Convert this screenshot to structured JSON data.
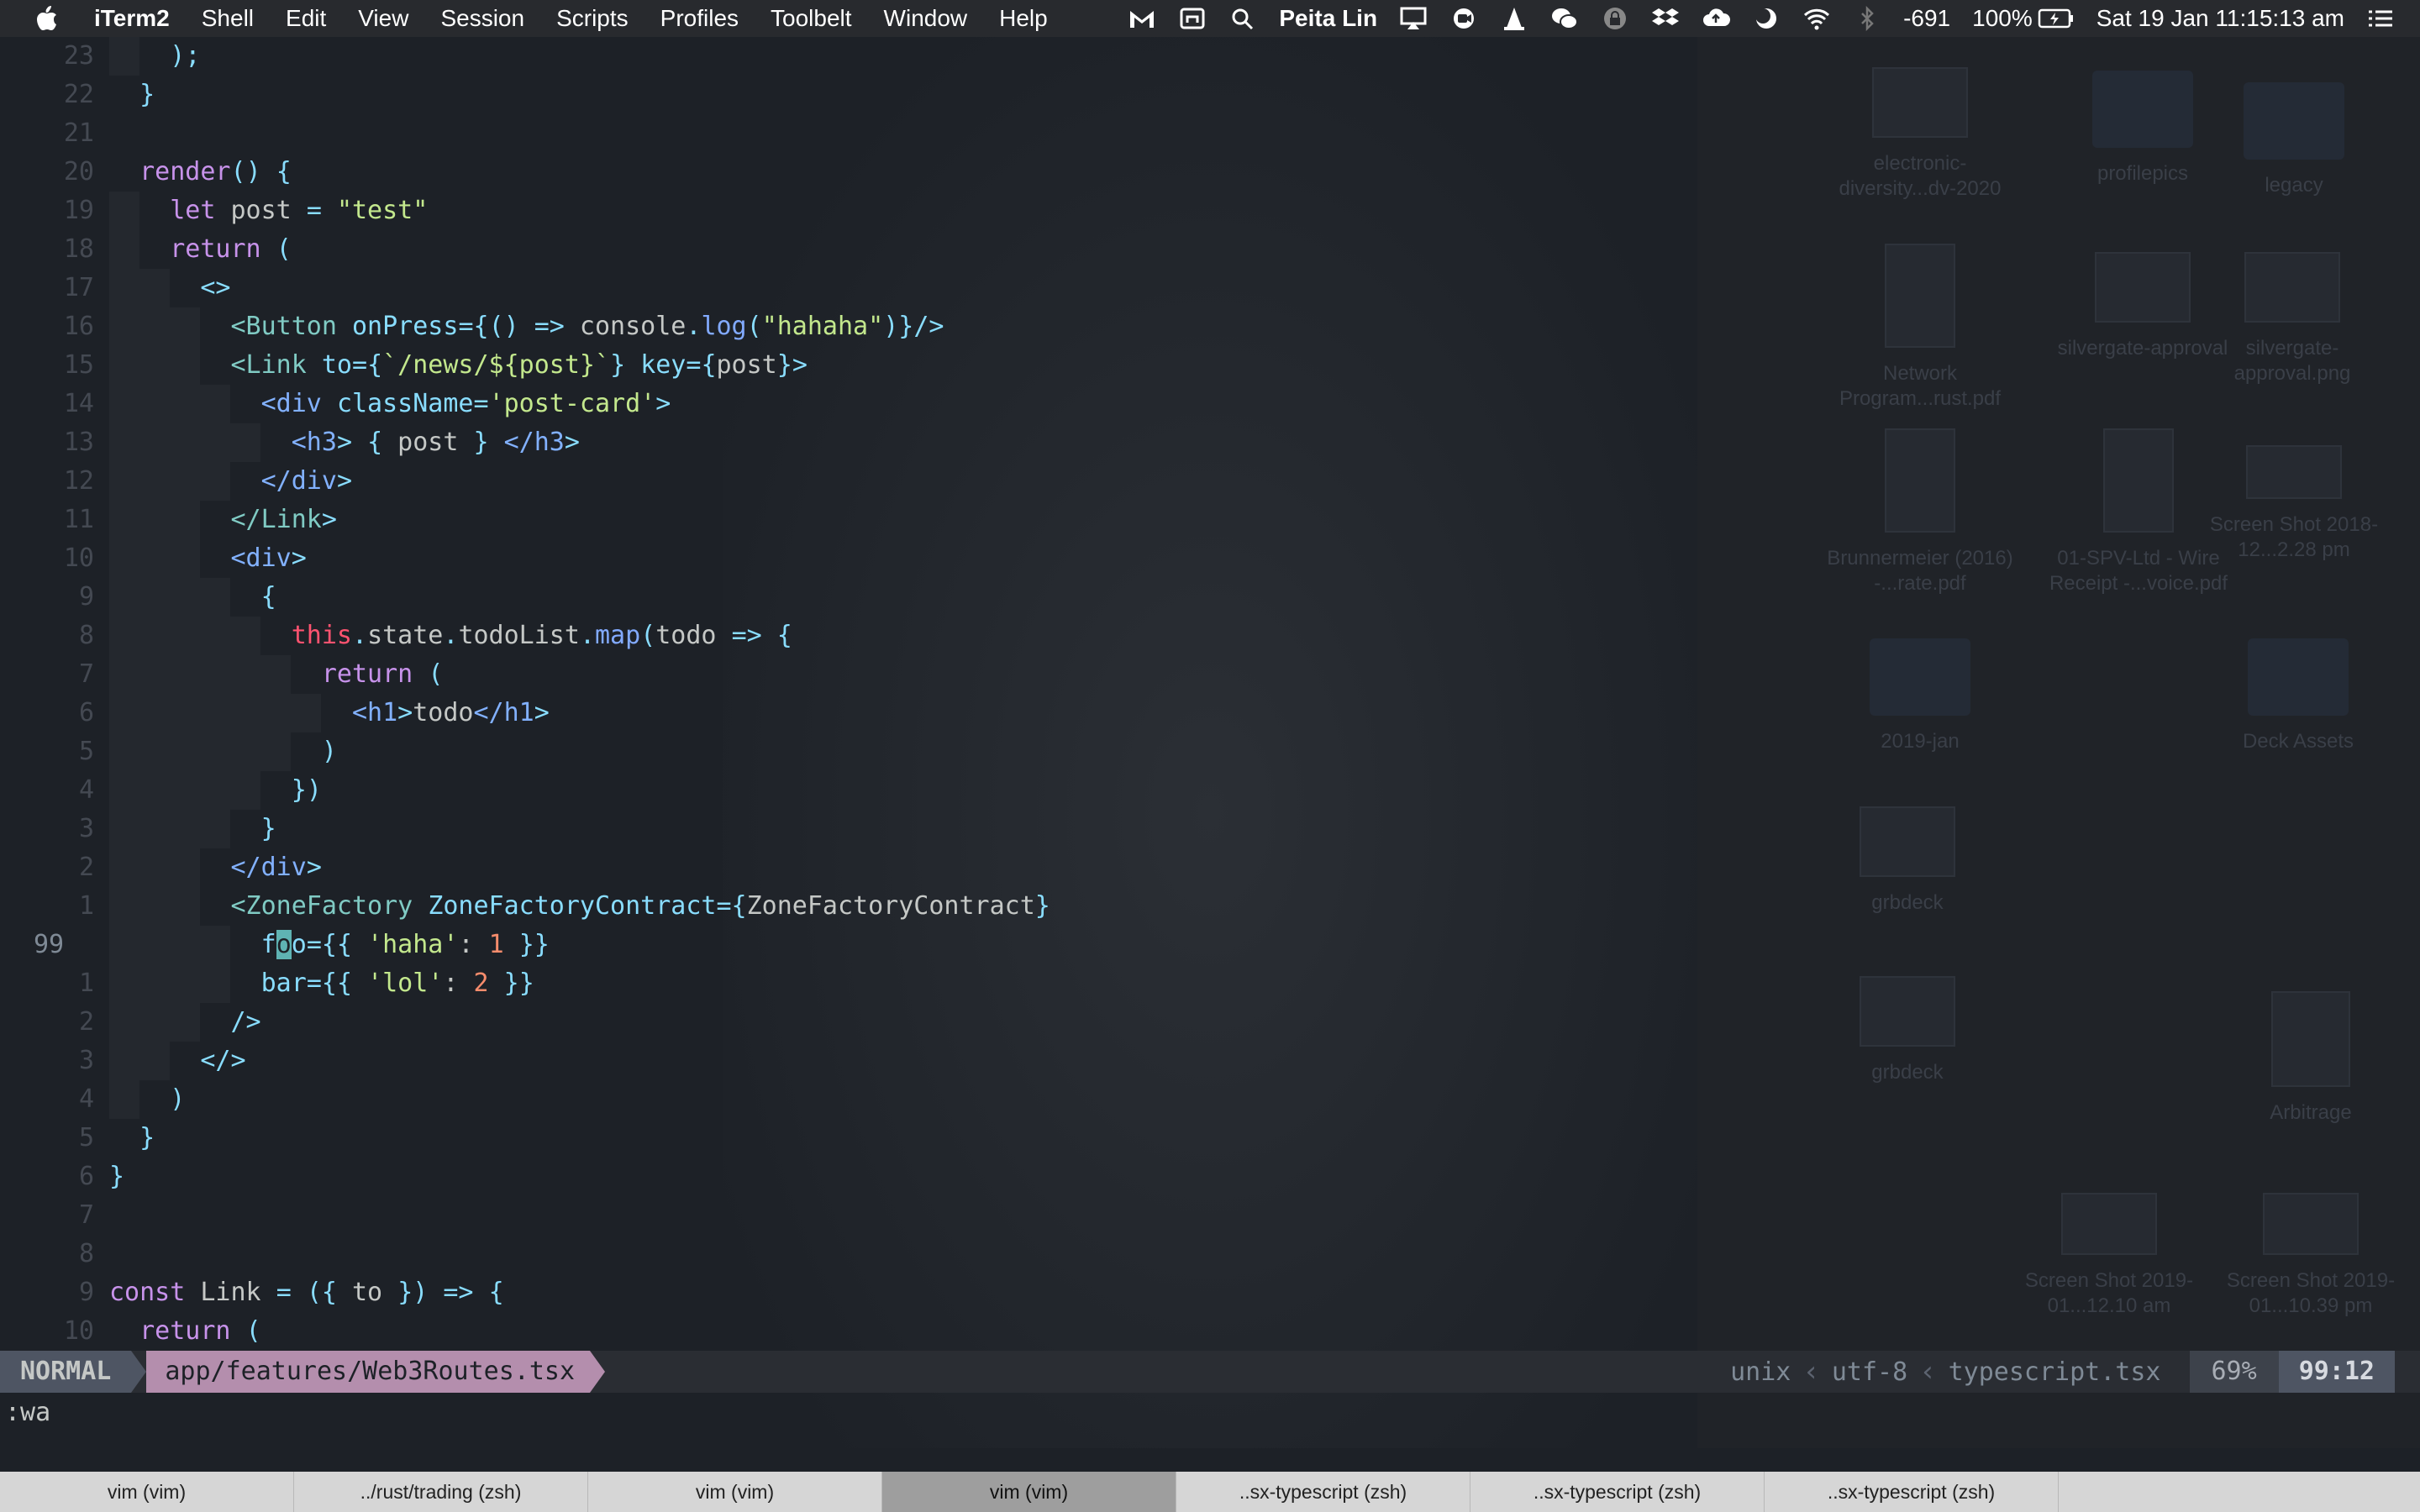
{
  "menubar": {
    "app_name": "iTerm2",
    "items": [
      "Shell",
      "Edit",
      "View",
      "Session",
      "Scripts",
      "Profiles",
      "Toolbelt",
      "Window",
      "Help"
    ],
    "user": "Peita Lin",
    "indicator_value": "-691",
    "battery": "100%",
    "datetime": "Sat 19 Jan  11:15:13 am",
    "status_icons": [
      "gmail-icon",
      "screen-icon",
      "search-icon",
      "airplay-icon",
      "record-icon",
      "vlc-icon",
      "wechat-icon",
      "lock-icon",
      "dropbox-icon",
      "cloud-upload-icon",
      "moon-icon",
      "wifi-icon",
      "bluetooth-icon",
      "battery-icon",
      "list-icon"
    ]
  },
  "desktop": {
    "items": [
      "electronic-diversity...dv-2020",
      "profilepics",
      "legacy",
      "Network Program...rust.pdf",
      "silvergate-approval",
      "silvergate-approval.png",
      "Brunnermeier (2016) -...rate.pdf",
      "01-SPV-Ltd - Wire Receipt -...voice.pdf",
      "Screen Shot 2018-12...2.28 pm",
      "2019-jan",
      "Deck Assets",
      "grbdeck",
      "grbdeck",
      "Arbitrage",
      "Screen Shot 2019-01...12.10 am",
      "Screen Shot 2019-01...10.39 pm"
    ]
  },
  "editor": {
    "line_numbers": [
      "23",
      "22",
      "21",
      "20",
      "19",
      "18",
      "17",
      "16",
      "15",
      "14",
      "13",
      "12",
      "11",
      "10",
      "9",
      "8",
      "7",
      "6",
      "5",
      "4",
      "3",
      "2",
      "1",
      "99",
      "1",
      "2",
      "3",
      "4",
      "5",
      "6",
      "7",
      "8",
      "9",
      "10"
    ],
    "lines": [
      "    );",
      "  }",
      "",
      "  render() {",
      "    let post = \"test\"",
      "    return (",
      "      <>",
      "        <Button onPress={() => console.log(\"hahaha\")}/>",
      "        <Link to={`/news/${post}`} key={post}>",
      "          <div className='post-card'>",
      "            <h3> { post } </h3>",
      "          </div>",
      "        </Link>",
      "        <div>",
      "          {",
      "            this.state.todoList.map(todo => {",
      "              return (",
      "                <h1>todo</h1>",
      "              )",
      "            })",
      "          }",
      "        </div>",
      "        <ZoneFactory ZoneFactoryContract={ZoneFactoryContract}",
      "          foo={{ 'haha': 1 }}",
      "          bar={{ 'lol': 2 }}",
      "        />",
      "      </>",
      "    )",
      "  }",
      "}",
      "",
      "",
      "const Link = ({ to }) => {",
      "  return ("
    ]
  },
  "statusline": {
    "mode": "NORMAL",
    "file": "app/features/Web3Routes.tsx",
    "fileformat": "unix",
    "encoding": "utf-8",
    "filetype": "typescript.tsx",
    "percent": "69%",
    "position": "99:12"
  },
  "cmdline": ":wa",
  "tabs": [
    {
      "label": "vim (vim)",
      "active": false
    },
    {
      "label": "../rust/trading (zsh)",
      "active": false
    },
    {
      "label": "vim (vim)",
      "active": false
    },
    {
      "label": "vim (vim)",
      "active": true
    },
    {
      "label": "..sx-typescript (zsh)",
      "active": false
    },
    {
      "label": "..sx-typescript (zsh)",
      "active": false
    },
    {
      "label": "..sx-typescript (zsh)",
      "active": false
    }
  ],
  "colors": {
    "background": "#1d2127",
    "keyword": "#c792ea",
    "tag": "#82b1ff",
    "string": "#c3e88d",
    "number": "#f78c6c",
    "mode_bg": "#4e5563",
    "file_bg": "#b48ead"
  }
}
